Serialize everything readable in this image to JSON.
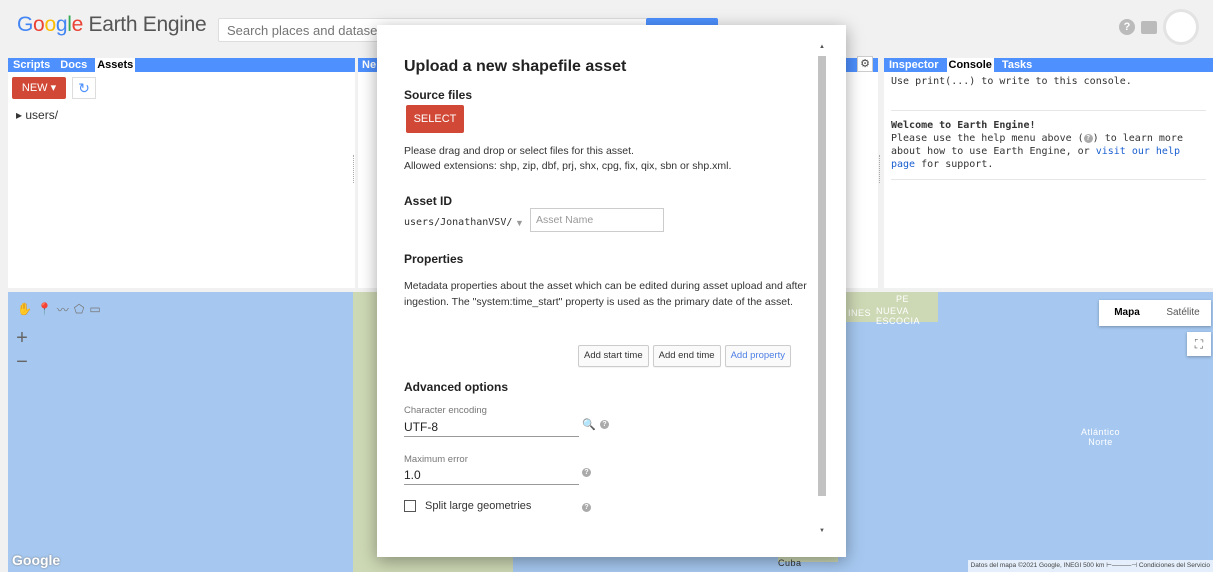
{
  "topbar": {
    "logo_letters": [
      "G",
      "o",
      "o",
      "g",
      "l",
      "e"
    ],
    "logo_rest": "Earth Engine",
    "search_placeholder": "Search places and datasets..."
  },
  "left_panel": {
    "tabs": [
      "Scripts",
      "Docs",
      "Assets"
    ],
    "active_tab": "Assets",
    "new_label": "NEW ▾",
    "tree_root": "▸ users/"
  },
  "mid_panel": {
    "tab_label": "Ne"
  },
  "right_panel": {
    "tabs": [
      "Inspector",
      "Console",
      "Tasks"
    ],
    "active_tab": "Console",
    "console_hint": "Use print(...) to write to this console.",
    "welcome": "Welcome to Earth Engine!",
    "body_1": "Please use the help menu above (",
    "body_2": ") to learn more about how to use Earth Engine, or ",
    "link": "visit our help page",
    "body_3": " for support."
  },
  "map": {
    "maptype_on": "Mapa",
    "maptype_off": "Satélite",
    "label_nueva": "NUEVA\nESCOCIA",
    "label_pe": "PE",
    "label_atl": "Atlántico\nNorte",
    "label_cuba": "Cuba",
    "label_ines": "INES",
    "google_wm": "Google",
    "attribution": "Datos del mapa ©2021 Google, INEGI   500 km ⊢———⊣     Condiciones del Servicio"
  },
  "dialog": {
    "title": "Upload a new shapefile asset",
    "source_files_heading": "Source files",
    "select_label": "SELECT",
    "drag_text_1": "Please drag and drop or select files for this asset.",
    "drag_text_2": "Allowed extensions: shp, zip, dbf, prj, shx, cpg, fix, qix, sbn or shp.xml.",
    "asset_id_heading": "Asset ID",
    "asset_prefix": "users/JonathanVSV/",
    "asset_name_placeholder": "Asset Name",
    "properties_heading": "Properties",
    "properties_text": "Metadata properties about the asset which can be edited during asset upload and after ingestion. The \"system:time_start\" property is used as the primary date of the asset.",
    "add_start_time": "Add start time",
    "add_end_time": "Add end time",
    "add_property": "Add property",
    "advanced_heading": "Advanced options",
    "char_encoding_label": "Character encoding",
    "char_encoding_value": "UTF-8",
    "max_error_label": "Maximum error",
    "max_error_value": "1.0",
    "split_label": "Split large geometries"
  },
  "colors": {
    "accent_blue": "#4d90fe",
    "button_red": "#d14836",
    "map_water": "#a6c8f0"
  }
}
